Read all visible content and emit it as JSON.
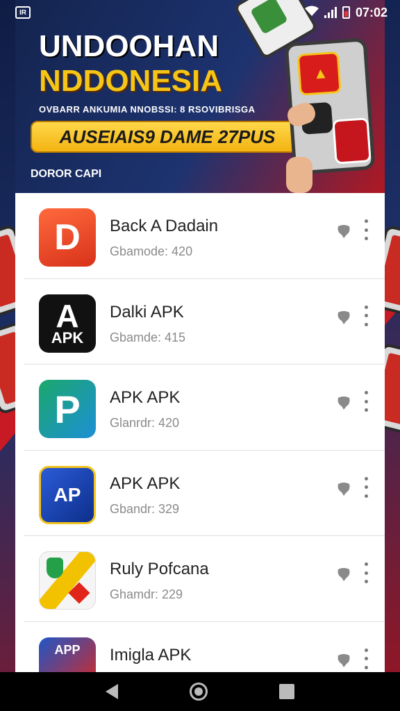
{
  "status_bar": {
    "time": "07:02"
  },
  "banner": {
    "title_line1": "UNDOOHAN",
    "title_line2": "NDDONESIA",
    "subtitle": "OVBARR ANKUMIA NNOBSSI: 8 RSOVIBRISGA",
    "cta_label": "AUSEIAIS9 DAME 27PUS",
    "footer_label": "DOROR CAPI"
  },
  "apps": [
    {
      "name": "Back A Dadain",
      "meta": "Gbamode: 420",
      "icon": "d-arrow-icon",
      "icon_text": "D"
    },
    {
      "name": "Dalki APK",
      "meta": "Gbamde: 415",
      "icon": "apk-a-icon",
      "icon_text": "A",
      "icon_text2": "APK"
    },
    {
      "name": "APK APK",
      "meta": "Glanrdr: 420",
      "icon": "p-shield-icon",
      "icon_text": "P"
    },
    {
      "name": "APK APK",
      "meta": "Gbandr: 329",
      "icon": "ap-icon",
      "icon_text": "AP"
    },
    {
      "name": "Ruly Pofcana",
      "meta": "Ghamdr: 229",
      "icon": "map-pin-icon",
      "icon_text": ""
    },
    {
      "name": "Imigla APK",
      "meta": "",
      "icon": "app-store-icon",
      "icon_text": "APP"
    }
  ]
}
